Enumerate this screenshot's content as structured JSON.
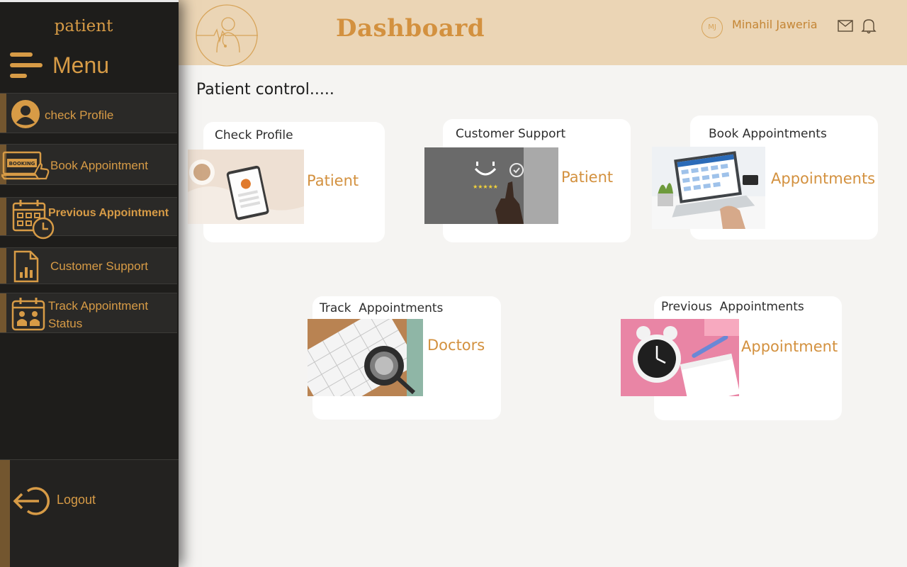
{
  "sidebar": {
    "brand": "patient",
    "menu_title": "Menu",
    "items": [
      {
        "label": "check Profile",
        "icon": "user-icon"
      },
      {
        "label": "Book Appointment",
        "icon": "booking-laptop-icon"
      },
      {
        "label": "Previous Appointment",
        "icon": "calendar-clock-icon"
      },
      {
        "label": "Customer Support",
        "icon": "document-chart-icon"
      },
      {
        "label_line1": "Track Appointment",
        "label_line2": "Status",
        "icon": "calendar-people-icon"
      }
    ],
    "logout_label": "Logout",
    "booking_badge": "BOOKING"
  },
  "header": {
    "title": "Dashboard",
    "user_initials": "MJ",
    "user_name": "Minahil Jaweria",
    "icons": [
      "mail-icon",
      "bell-icon"
    ]
  },
  "main": {
    "section_title": "Patient control.....",
    "cards": [
      {
        "title": "Check Profile",
        "label": "Patient"
      },
      {
        "title": "Customer Support",
        "label": "Patient"
      },
      {
        "title": "Book Appointments",
        "label": "Appointments"
      },
      {
        "title": "Track  Appointments",
        "label": "Doctors"
      },
      {
        "title": "Previous  Appointments",
        "label": "Appointment"
      }
    ]
  },
  "colors": {
    "accent": "#d3913f",
    "sidebar_bg": "#1e1d1b",
    "header_bg": "#ebd5b5",
    "content_bg": "#f5f4f2"
  }
}
